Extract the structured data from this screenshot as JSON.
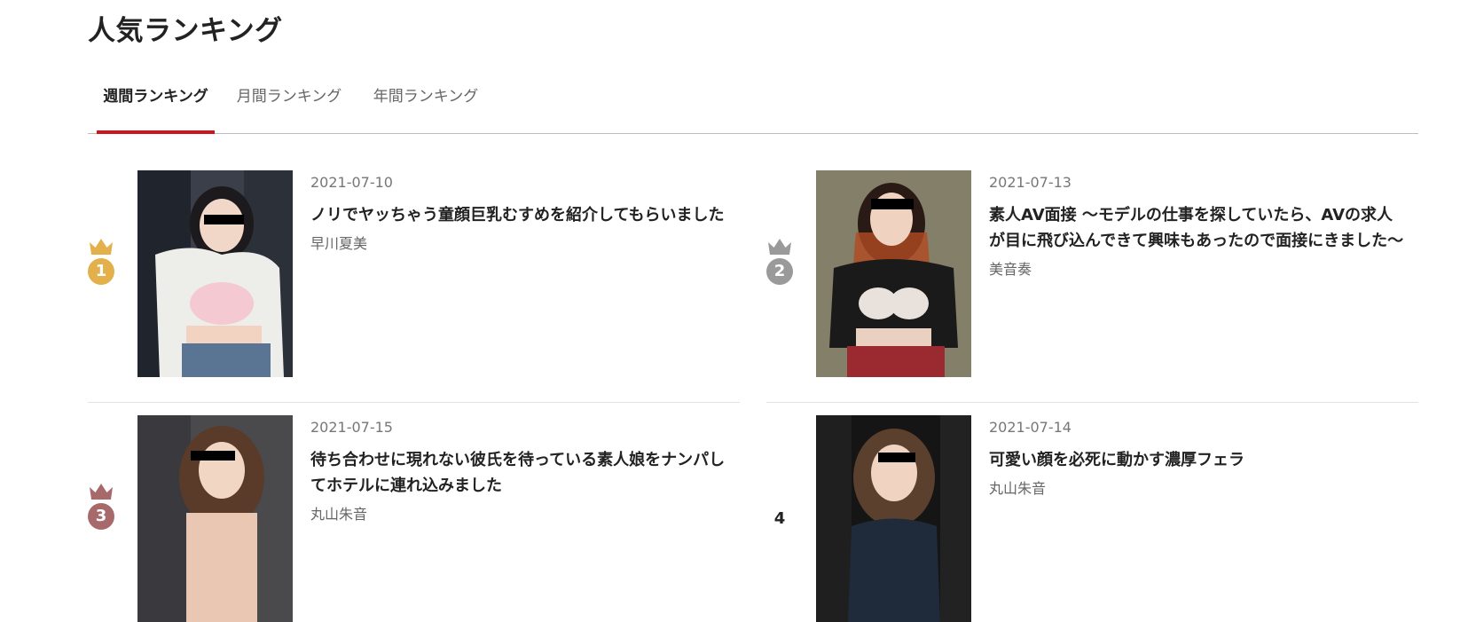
{
  "page_title": "人気ランキング",
  "tabs": [
    {
      "label": "週間ランキング",
      "active": true
    },
    {
      "label": "月間ランキング",
      "active": false
    },
    {
      "label": "年間ランキング",
      "active": false
    }
  ],
  "rank_colors": {
    "gold": "#e3b04b",
    "silver": "#9a9a9a",
    "bronze": "#a8696b",
    "accent": "#d0141b"
  },
  "items": [
    {
      "rank": "1",
      "date": "2021-07-10",
      "title": "ノリでヤッちゃう童顔巨乳むすめを紹介してもらいました",
      "actress": "早川夏美",
      "rank_icon": "crown-gold-icon"
    },
    {
      "rank": "2",
      "date": "2021-07-13",
      "title": "素人AV面接 ～モデルの仕事を探していたら、AVの求人が目に飛び込んできて興味もあったので面接にきました～",
      "actress": "美音奏",
      "rank_icon": "crown-silver-icon"
    },
    {
      "rank": "3",
      "date": "2021-07-15",
      "title": "待ち合わせに現れない彼氏を待っている素人娘をナンパしてホテルに連れ込みました",
      "actress": "丸山朱音",
      "rank_icon": "crown-bronze-icon"
    },
    {
      "rank": "4",
      "date": "2021-07-14",
      "title": "可愛い顔を必死に動かす濃厚フェラ",
      "actress": "丸山朱音",
      "rank_icon": ""
    }
  ]
}
